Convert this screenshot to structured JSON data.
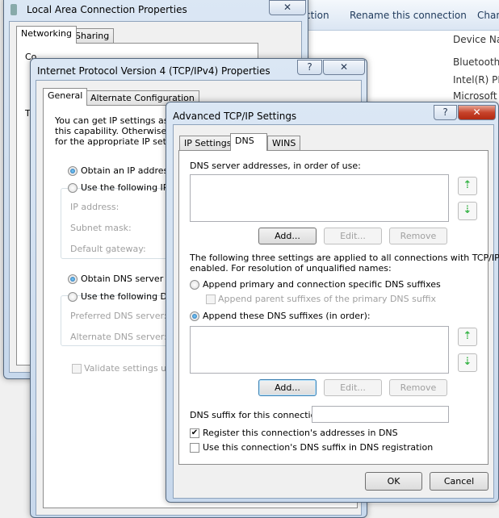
{
  "explorer": {
    "toolbar": [
      "ction",
      "Rename this connection",
      "Chan"
    ],
    "column_header": "Device Nar",
    "devices": [
      "Bluetooth",
      "Intel(R) PR",
      "Microsoft V"
    ]
  },
  "lac": {
    "title": "Local Area Connection Properties",
    "tabs": [
      "Networking",
      "Sharing"
    ],
    "connect_label": "Co",
    "t_label": "T",
    "close": "✕"
  },
  "ipv4": {
    "title": "Internet Protocol Version 4 (TCP/IPv4) Properties",
    "help": "?",
    "close": "✕",
    "tabs": [
      "General",
      "Alternate Configuration"
    ],
    "intro": [
      "You can get IP settings assig",
      "this capability. Otherwise, yo",
      "for the appropriate IP setting"
    ],
    "obtain_ip": "Obtain an IP address au",
    "use_ip": "Use the following IP add",
    "ip_address": "IP address:",
    "subnet": "Subnet mask:",
    "gateway": "Default gateway:",
    "obtain_dns": "Obtain DNS server addr",
    "use_dns": "Use the following DNS se",
    "preferred": "Preferred DNS server:",
    "alternate": "Alternate DNS server:",
    "validate": "Validate settings upon e"
  },
  "adv": {
    "title": "Advanced TCP/IP Settings",
    "help": "?",
    "close": "✕",
    "tabs": [
      "IP Settings",
      "DNS",
      "WINS"
    ],
    "dns_servers_label": "DNS server addresses, in order of use:",
    "add": "Add...",
    "edit": "Edit...",
    "remove": "Remove",
    "info": [
      "The following three settings are applied to all connections with TCP/IP",
      "enabled. For resolution of unqualified names:"
    ],
    "append_primary": "Append primary and connection specific DNS suffixes",
    "append_parent": "Append parent suffixes of the primary DNS suffix",
    "append_these": "Append these DNS suffixes (in order):",
    "suffix_label": "DNS suffix for this connection:",
    "suffix_value": "",
    "register": "Register this connection's addresses in DNS",
    "use_suffix": "Use this connection's DNS suffix in DNS registration",
    "ok": "OK",
    "cancel": "Cancel",
    "up": "⇡",
    "down": "⇣"
  },
  "colors": {
    "accent": "#3c7fb1",
    "close_red": "#c7432b",
    "arrow_green": "#3bb54a"
  }
}
